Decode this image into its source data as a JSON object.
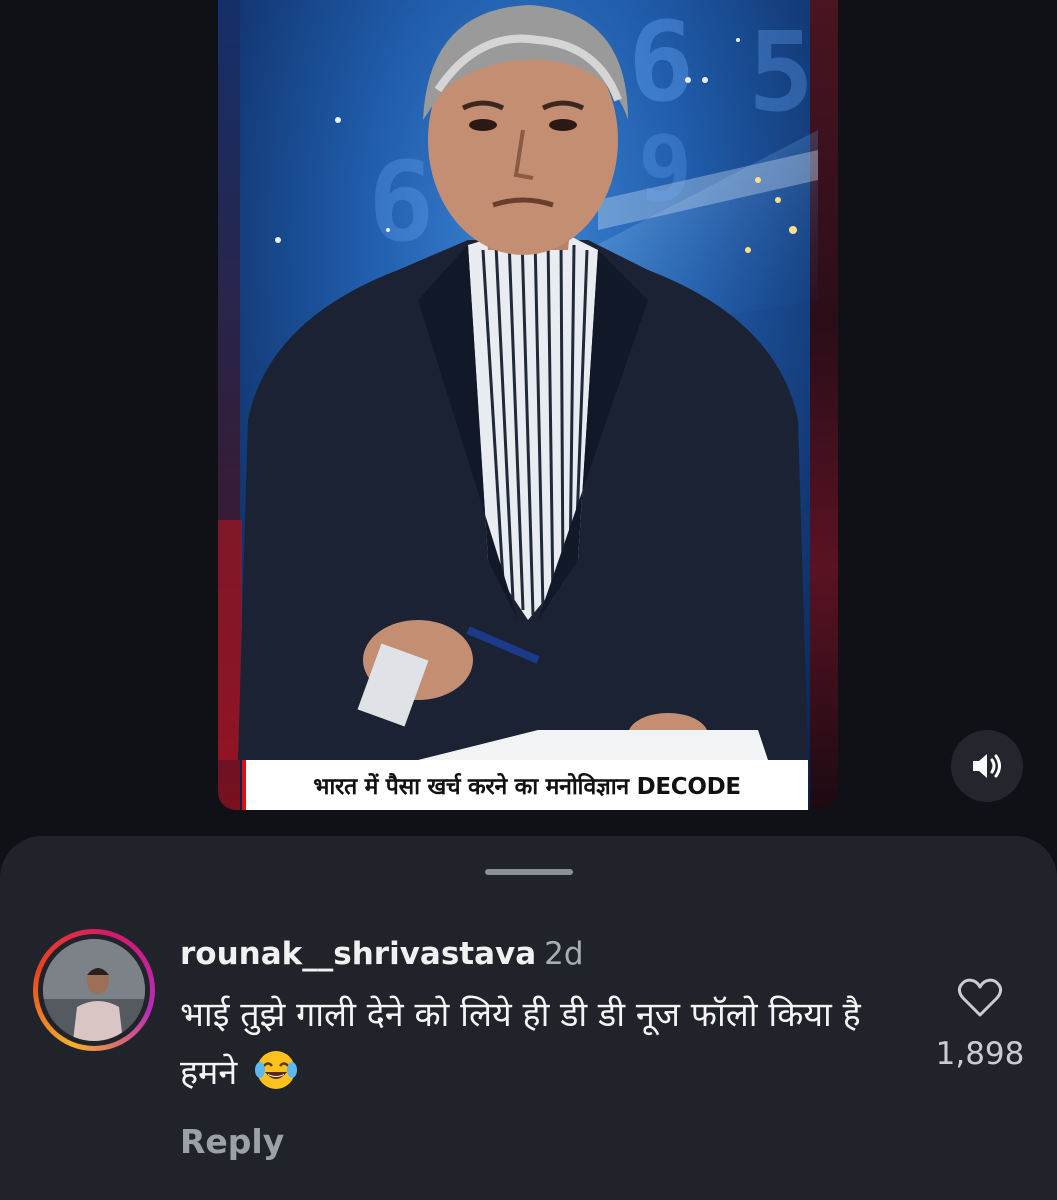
{
  "video": {
    "caption": "भारत में पैसा खर्च करने का मनोविज्ञान DECODE"
  },
  "controls": {
    "mute_icon": "speaker-sound-icon"
  },
  "comment": {
    "username": "rounak__shrivastava",
    "time": "2d",
    "text": "भाई तुझे गाली देने को लिये ही डी डी नूज फॉलो किया है हमने",
    "emoji": "😂",
    "reply_label": "Reply",
    "like_count": "1,898",
    "like_icon": "heart-outline-icon"
  },
  "colors": {
    "background": "#0f1117",
    "sheet": "#21232a",
    "text": "#f4f4f4",
    "muted": "#9ca0a7"
  }
}
